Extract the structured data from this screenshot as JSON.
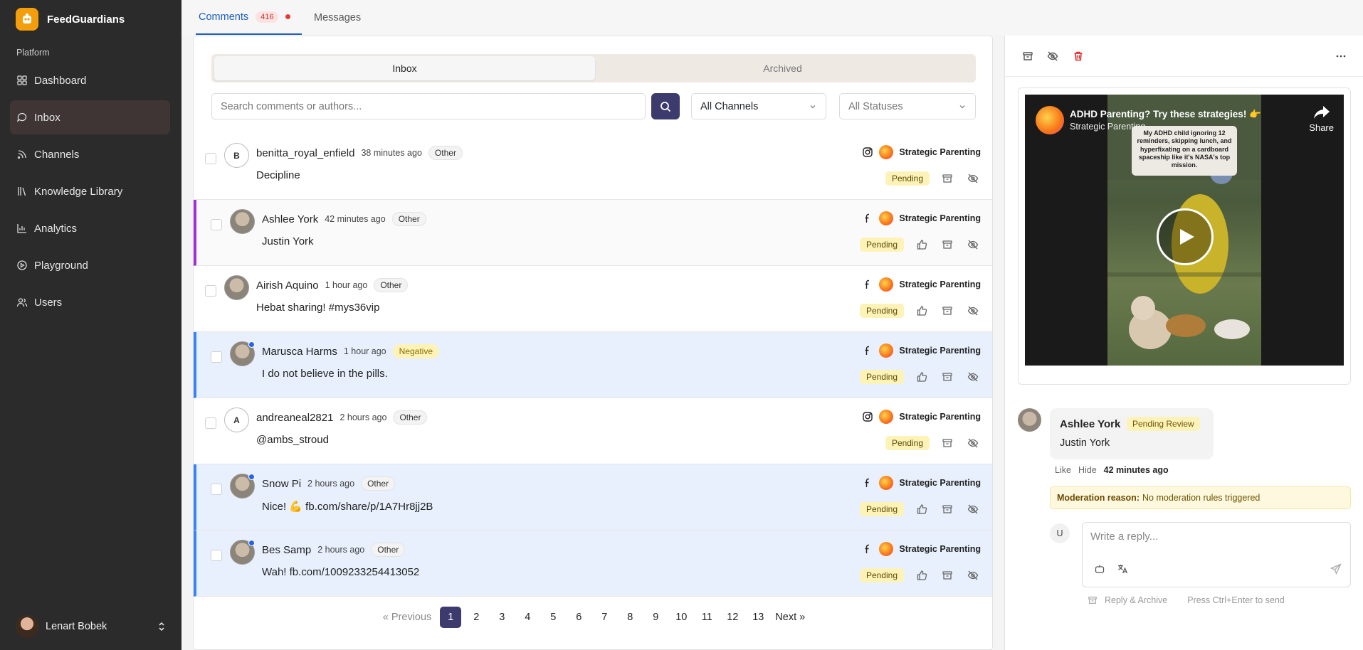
{
  "app": {
    "name": "FeedGuardians",
    "section_label": "Platform"
  },
  "nav": [
    {
      "label": "Dashboard",
      "icon": "dashboard-icon",
      "active": false
    },
    {
      "label": "Inbox",
      "icon": "inbox-icon",
      "active": true
    },
    {
      "label": "Channels",
      "icon": "channels-icon",
      "active": false
    },
    {
      "label": "Knowledge Library",
      "icon": "library-icon",
      "active": false
    },
    {
      "label": "Analytics",
      "icon": "analytics-icon",
      "active": false
    },
    {
      "label": "Playground",
      "icon": "playground-icon",
      "active": false
    },
    {
      "label": "Users",
      "icon": "users-icon",
      "active": false
    }
  ],
  "user": {
    "name": "Lenart Bobek"
  },
  "tabs": {
    "comments": "Comments",
    "comments_count": "416",
    "messages": "Messages"
  },
  "filters": {
    "inbox": "Inbox",
    "archived": "Archived",
    "search_placeholder": "Search comments or authors...",
    "channels": "All Channels",
    "statuses": "All Statuses"
  },
  "comments": [
    {
      "author": "benitta_royal_enfield",
      "initial": "B",
      "time": "38 minutes ago",
      "tag": "Other",
      "text": "Decipline",
      "platform": "instagram",
      "channel": "Strategic Parenting",
      "status": "Pending",
      "style": "plain",
      "like": false
    },
    {
      "author": "Ashlee York",
      "initial": "",
      "time": "42 minutes ago",
      "tag": "Other",
      "text": "Justin York",
      "platform": "facebook",
      "channel": "Strategic Parenting",
      "status": "Pending",
      "style": "selected",
      "like": true
    },
    {
      "author": "Airish Aquino",
      "initial": "",
      "time": "1 hour ago",
      "tag": "Other",
      "text": "Hebat sharing! #mys36vip",
      "platform": "facebook",
      "channel": "Strategic Parenting",
      "status": "Pending",
      "style": "plain",
      "like": true
    },
    {
      "author": "Marusca Harms",
      "initial": "",
      "time": "1 hour ago",
      "tag": "Negative",
      "text": "I do not believe in the pills.",
      "platform": "facebook",
      "channel": "Strategic Parenting",
      "status": "Pending",
      "style": "unread",
      "like": true
    },
    {
      "author": "andreaneal2821",
      "initial": "A",
      "time": "2 hours ago",
      "tag": "Other",
      "text": "@ambs_stroud",
      "platform": "instagram",
      "channel": "Strategic Parenting",
      "status": "Pending",
      "style": "plain",
      "like": false
    },
    {
      "author": "Snow Pi",
      "initial": "",
      "time": "2 hours ago",
      "tag": "Other",
      "text": "Nice! 💪 fb.com/share/p/1A7Hr8jj2B",
      "platform": "facebook",
      "channel": "Strategic Parenting",
      "status": "Pending",
      "style": "unread",
      "like": true
    },
    {
      "author": "Bes Samp",
      "initial": "",
      "time": "2 hours ago",
      "tag": "Other",
      "text": "Wah! fb.com/1009233254413052",
      "platform": "facebook",
      "channel": "Strategic Parenting",
      "status": "Pending",
      "style": "unread",
      "like": true
    }
  ],
  "pagination": {
    "previous": "« Previous",
    "next": "Next »",
    "pages": [
      "1",
      "2",
      "3",
      "4",
      "5",
      "6",
      "7",
      "8",
      "9",
      "10",
      "11",
      "12",
      "13"
    ],
    "current": "1"
  },
  "detail": {
    "video_title": "ADHD Parenting? Try these strategies! 👉",
    "video_channel": "Strategic Parenting",
    "share": "Share",
    "video_caption": "My ADHD child ignoring 12 reminders, skipping lunch, and hyperfixating on a cardboard spaceship like it's NASA's top mission.",
    "comment_author": "Ashlee York",
    "comment_status": "Pending Review",
    "comment_text": "Justin York",
    "like": "Like",
    "hide": "Hide",
    "comment_time": "42 minutes ago",
    "moderation_label": "Moderation reason:",
    "moderation_value": "No moderation rules triggered",
    "reply_initial": "U",
    "reply_placeholder": "Write a reply...",
    "reply_archive": "Reply & Archive",
    "send_hint": "Press Ctrl+Enter to send"
  },
  "colors": {
    "accent": "#3d3b6e",
    "link": "#1d5fbf",
    "pending": "#fdf3b8",
    "unread_border": "#3b82f6",
    "selected_border": "#a42fd6"
  }
}
